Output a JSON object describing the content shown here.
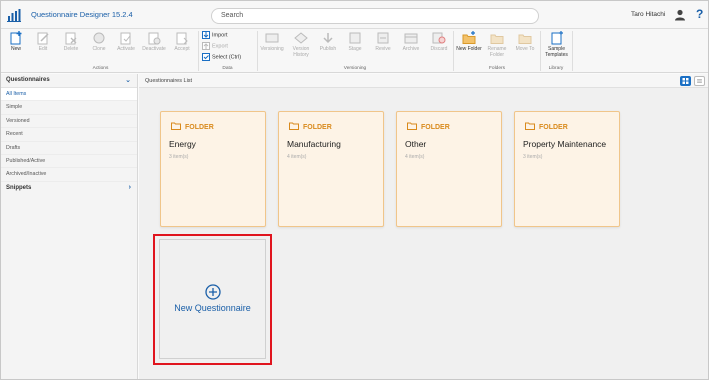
{
  "app": {
    "title": "Questionnaire Designer 15.2.4"
  },
  "search": {
    "placeholder": "Search"
  },
  "user": {
    "name": "Taro Hitachi"
  },
  "help": {
    "label": "?"
  },
  "ribbon": {
    "actions": {
      "label": "Actions",
      "buttons": [
        "New",
        "Edit",
        "Delete",
        "Clone",
        "Activate",
        "Deactivate",
        "Accept"
      ]
    },
    "data": {
      "label": "Data",
      "buttons": [
        "Import",
        "Export",
        "Select (Ctrl)"
      ]
    },
    "versioning": {
      "label": "Versioning",
      "buttons": [
        "Versioning",
        "Version History",
        "Publish",
        "Stage",
        "Revive",
        "Archive",
        "Discard"
      ]
    },
    "folders": {
      "label": "Folders",
      "buttons": [
        "New Folder",
        "Rename Folder",
        "Move To"
      ]
    },
    "library": {
      "label": "Library",
      "buttons": [
        "Sample Templates"
      ]
    }
  },
  "sidebar": {
    "section_title": "Questionnaires",
    "items": [
      "All Items",
      "Simple",
      "Versioned",
      "Recent",
      "Drafts",
      "Published/Active",
      "Archived/Inactive"
    ],
    "snippets_title": "Snippets"
  },
  "main": {
    "title": "Questionnaires List",
    "folder_tag": "FOLDER",
    "folders": [
      {
        "name": "Energy",
        "count": "3 item(s)"
      },
      {
        "name": "Manufacturing",
        "count": "4 item(s)"
      },
      {
        "name": "Other",
        "count": "4 item(s)"
      },
      {
        "name": "Property Maintenance",
        "count": "3 item(s)"
      }
    ],
    "new_questionnaire": "New Questionnaire"
  },
  "colors": {
    "accent": "#1a5fa8",
    "folder_bg": "#fdf3e6",
    "folder_border": "#f0c58a",
    "folder_tag": "#d98a1c",
    "highlight": "#e0141e"
  }
}
